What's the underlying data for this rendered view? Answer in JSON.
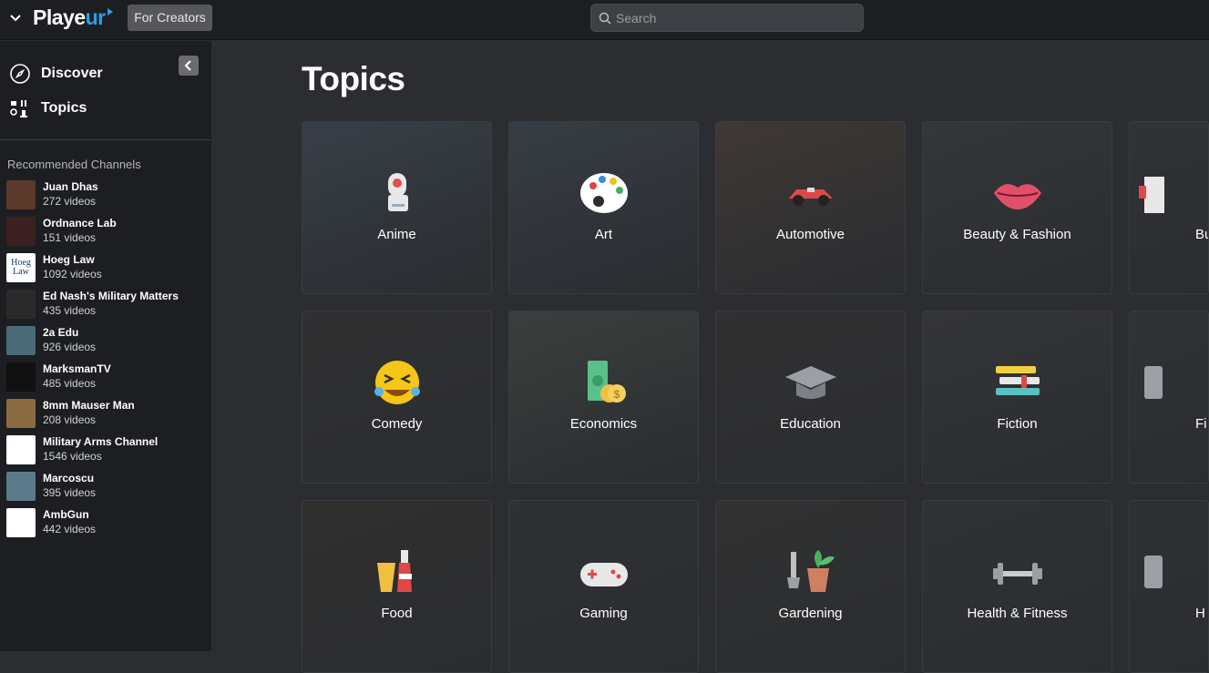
{
  "header": {
    "logo_main": "Playe",
    "logo_accent": "ur",
    "creators_label": "For Creators",
    "search_placeholder": "Search"
  },
  "sidebar": {
    "nav": [
      {
        "label": "Discover",
        "icon": "compass-icon"
      },
      {
        "label": "Topics",
        "icon": "topics-icon"
      }
    ],
    "recommended_title": "Recommended Channels",
    "channels": [
      {
        "name": "Juan Dhas",
        "count": "272 videos",
        "color": "#5a3a2a"
      },
      {
        "name": "Ordnance Lab",
        "count": "151 videos",
        "color": "#3a2020"
      },
      {
        "name": "Hoeg Law",
        "count": "1092 videos",
        "color": "#ffffff",
        "mark": "Hoeg Law"
      },
      {
        "name": "Ed Nash's Military Matters",
        "count": "435 videos",
        "color": "#2a2a2a"
      },
      {
        "name": "2a Edu",
        "count": "926 videos",
        "color": "#4a6a78"
      },
      {
        "name": "MarksmanTV",
        "count": "485 videos",
        "color": "#111111"
      },
      {
        "name": "8mm Mauser Man",
        "count": "208 videos",
        "color": "#8a6a40"
      },
      {
        "name": "Military Arms Channel",
        "count": "1546 videos",
        "color": "#ffffff"
      },
      {
        "name": "Marcoscu",
        "count": "395 videos",
        "color": "#5a7a8a"
      },
      {
        "name": "AmbGun",
        "count": "442 videos",
        "color": "#ffffff"
      }
    ]
  },
  "main": {
    "title": "Topics",
    "topics": [
      {
        "label": "Anime",
        "icon": "robot-icon",
        "bg": "#4a5a66"
      },
      {
        "label": "Art",
        "icon": "palette-icon",
        "bg": "#4a5560"
      },
      {
        "label": "Automotive",
        "icon": "race-car-icon",
        "bg": "#5a4a40"
      },
      {
        "label": "Beauty & Fashion",
        "icon": "lips-icon",
        "bg": "#44464a"
      },
      {
        "label": "Bu",
        "icon": "building-icon",
        "bg": "#3c3e42"
      },
      {
        "label": "Comedy",
        "icon": "laughing-face-icon",
        "bg": "#3c3a38"
      },
      {
        "label": "Economics",
        "icon": "money-icon",
        "bg": "#505a50"
      },
      {
        "label": "Education",
        "icon": "graduation-cap-icon",
        "bg": "#3e3a36"
      },
      {
        "label": "Fiction",
        "icon": "books-icon",
        "bg": "#444444"
      },
      {
        "label": "Fi",
        "icon": "generic-icon",
        "bg": "#3c3e42"
      },
      {
        "label": "Food",
        "icon": "drinks-icon",
        "bg": "#3a3630"
      },
      {
        "label": "Gaming",
        "icon": "gamepad-icon",
        "bg": "#383a3e"
      },
      {
        "label": "Gardening",
        "icon": "plant-pot-icon",
        "bg": "#3e3c38"
      },
      {
        "label": "Health & Fitness",
        "icon": "dumbbell-icon",
        "bg": "#3a3c40"
      },
      {
        "label": "H",
        "icon": "generic-icon",
        "bg": "#38393c"
      }
    ]
  }
}
